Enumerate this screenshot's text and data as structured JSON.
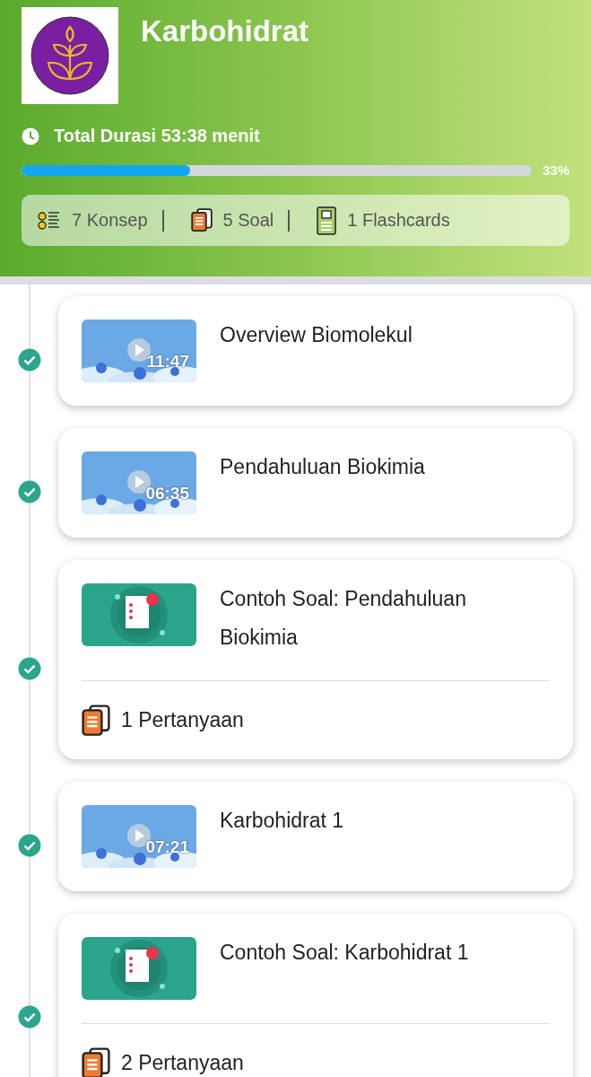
{
  "header": {
    "title": "Karbohidrat",
    "duration": "Total Durasi 53:38 menit",
    "progress": {
      "level": 0.33,
      "reading": "33%"
    },
    "stats": [
      {
        "kind": "konsep",
        "label": "7 Konsep"
      },
      {
        "kind": "soal",
        "label": "5 Soal"
      },
      {
        "kind": "flashcards",
        "label": "1 Flashcards"
      }
    ]
  },
  "items": [
    {
      "kind": "video",
      "title": "Overview Biomolekul",
      "duration": "11:47",
      "completed": true
    },
    {
      "kind": "video",
      "title": "Pendahuluan Biokimia",
      "duration": "06:35",
      "completed": true
    },
    {
      "kind": "quiz",
      "title": "Contoh Soal: Pendahuluan Biokimia",
      "count": "1 Pertanyaan",
      "completed": true
    },
    {
      "kind": "video",
      "title": "Karbohidrat 1",
      "duration": "07:21",
      "completed": true
    },
    {
      "kind": "quiz",
      "title": "Contoh Soal: Karbohidrat 1",
      "count": "2 Pertanyaan",
      "completed": true
    }
  ]
}
